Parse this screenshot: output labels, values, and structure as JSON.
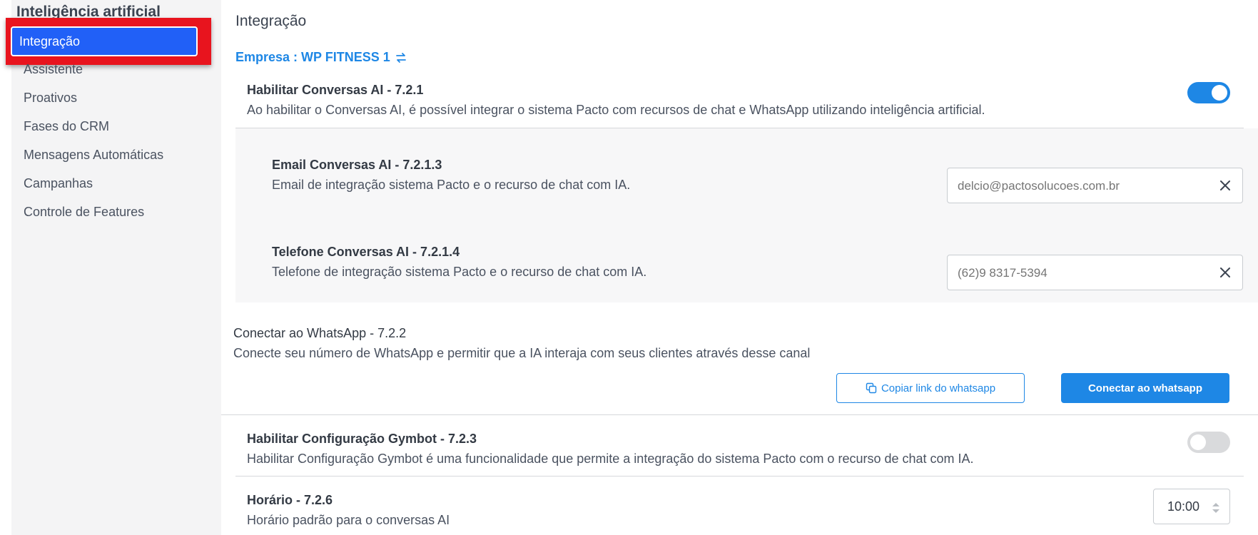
{
  "sidebar": {
    "title": "Inteligência artificial",
    "items": [
      {
        "label": "Integração",
        "active": true
      },
      {
        "label": "Assistente"
      },
      {
        "label": "Proativos"
      },
      {
        "label": "Fases do CRM"
      },
      {
        "label": "Mensagens Automáticas"
      },
      {
        "label": "Campanhas"
      },
      {
        "label": "Controle de Features"
      }
    ]
  },
  "main": {
    "title": "Integração",
    "company": "Empresa : WP FITNESS 1",
    "conversas_ai": {
      "title": "Habilitar Conversas AI - 7.2.1",
      "description": "Ao habilitar o Conversas AI, é possível integrar o sistema Pacto com recursos de chat e WhatsApp utilizando inteligência artificial.",
      "enabled": true
    },
    "email": {
      "title": "Email Conversas AI - 7.2.1.3",
      "description": "Email de integração sistema Pacto e o recurso de chat com IA.",
      "placeholder": "delcio@pactosolucoes.com.br"
    },
    "telefone": {
      "title": "Telefone Conversas AI - 7.2.1.4",
      "description": "Telefone de integração sistema Pacto e o recurso de chat com IA.",
      "placeholder": "(62)9 8317-5394"
    },
    "whatsapp": {
      "title": "Conectar ao WhatsApp - 7.2.2",
      "description": "Conecte seu número de WhatsApp e permitir que a IA interaja com seus clientes através desse canal",
      "copy_label": "Copiar link do whatsapp",
      "connect_label": "Conectar ao whatsapp"
    },
    "gymbot": {
      "title": "Habilitar Configuração Gymbot - 7.2.3",
      "description": "Habilitar Configuração Gymbot é uma funcionalidade que permite a integração do sistema Pacto com o recurso de chat com IA.",
      "enabled": false
    },
    "horario": {
      "title": "Horário - 7.2.6",
      "description": "Horário padrão para o conversas AI",
      "value": "10:00"
    }
  },
  "colors": {
    "accent": "#1e87e5",
    "active_nav": "#2160f7",
    "highlight": "#e8141e"
  }
}
